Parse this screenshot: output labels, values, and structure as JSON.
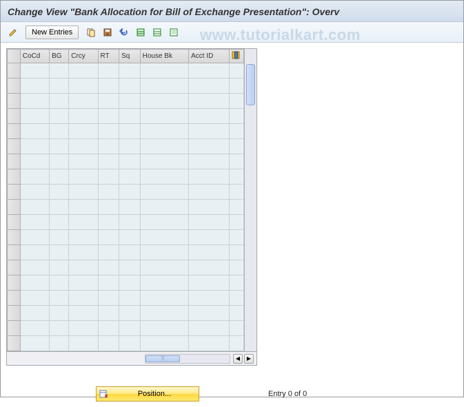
{
  "title": "Change View \"Bank Allocation for Bill of Exchange Presentation\": Overv",
  "watermark": "www.tutorialkart.com",
  "toolbar": {
    "new_entries": "New Entries"
  },
  "columns": {
    "cocd": "CoCd",
    "bg": "BG",
    "crcy": "Crcy",
    "rt": "RT",
    "sq": "Sq",
    "housebk": "House Bk",
    "acctid": "Acct ID"
  },
  "footer": {
    "position_label": "Position...",
    "entry_text": "Entry 0 of 0"
  },
  "icons": {
    "pencil": "pencil-icon",
    "copy": "copy-icon",
    "save": "save-icon",
    "undo": "undo-icon",
    "table1": "select-all-icon",
    "table2": "deselect-all-icon",
    "details": "details-icon",
    "config": "configure-icon"
  }
}
